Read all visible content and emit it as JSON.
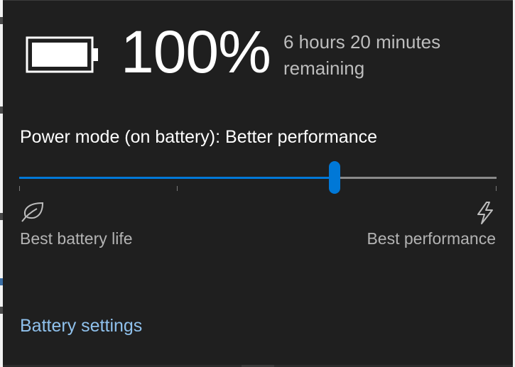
{
  "battery": {
    "icon": "battery-full-icon",
    "percent": "100%",
    "time_remaining": "6 hours 20 minutes remaining"
  },
  "power_mode": {
    "label": "Power mode (on battery): Better performance",
    "slider_position_fraction": 0.66,
    "tick_positions_fraction": [
      0.0,
      0.33,
      1.0
    ],
    "left_label": "Best battery life",
    "left_icon": "leaf-icon",
    "right_label": "Best performance",
    "right_icon": "lightning-bolt-icon"
  },
  "links": {
    "battery_settings": "Battery settings"
  },
  "colors": {
    "accent": "#0078d7",
    "link": "#8fc1ec",
    "background": "#1f1f1f"
  }
}
